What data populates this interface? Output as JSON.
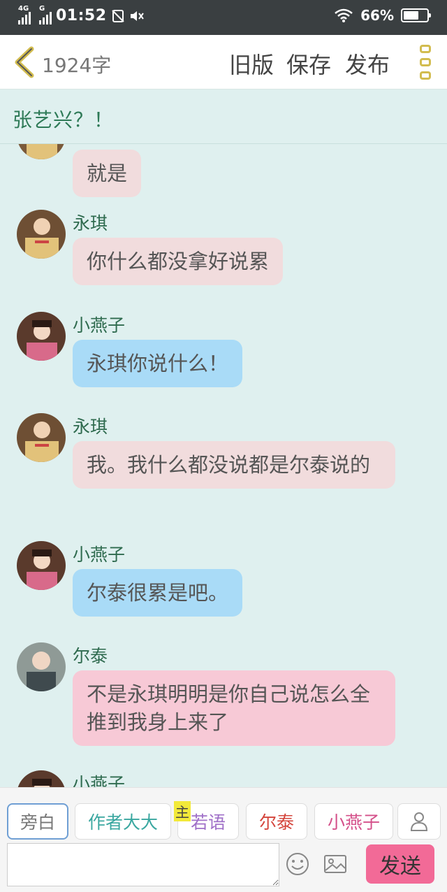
{
  "status": {
    "network1": "4G",
    "network2": "G",
    "time": "01:52",
    "battery_percent": 66,
    "battery_text": "66%"
  },
  "header": {
    "word_count": "1924字",
    "old_version": "旧版",
    "save": "保存",
    "publish": "发布"
  },
  "story": {
    "title": "张艺兴？！"
  },
  "messages": [
    {
      "name": "",
      "text": "就是"
    },
    {
      "name": "永琪",
      "text": "你什么都没拿好说累"
    },
    {
      "name": "小燕子",
      "text": "永琪你说什么！"
    },
    {
      "name": "永琪",
      "text": "我。我什么都没说都是尔泰说的"
    },
    {
      "name": "小燕子",
      "text": "尔泰很累是吧。"
    },
    {
      "name": "尔泰",
      "text": "不是永琪明明是你自己说怎么全推到我身上来了"
    },
    {
      "name": "小燕子",
      "text": ""
    }
  ],
  "roles": {
    "narration": "旁白",
    "author": "作者大大",
    "main_badge": "主",
    "ruoyu": "若语",
    "ertai": "尔泰",
    "xiaoyanzi": "小燕子"
  },
  "input": {
    "placeholder": "",
    "send": "发送"
  },
  "colors": {
    "accent_green": "#2e7a57",
    "send_button": "#f26a97",
    "bubble_pink": "#f1dcdd",
    "bubble_blue": "#a9dbf7",
    "bubble_rose": "#f7c9d6"
  }
}
